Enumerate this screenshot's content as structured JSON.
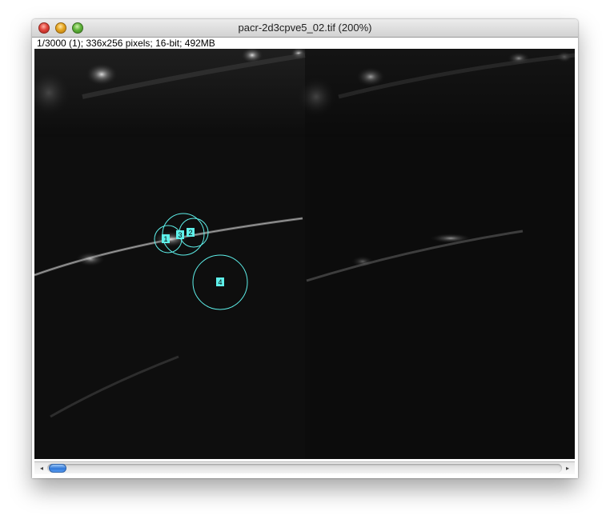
{
  "window": {
    "title": "pacr-2d3cpve5_02.tif (200%)",
    "info": "1/3000 (1); 336x256 pixels; 16-bit; 492MB"
  },
  "roi_color": "#5ef0ea",
  "rois": [
    {
      "label": "1"
    },
    {
      "label": "2"
    },
    {
      "label": "3"
    },
    {
      "label": "4"
    }
  ],
  "scrollbar": {
    "left_arrow": "◂",
    "right_arrow": "▸"
  },
  "icons": {
    "close": "close-button",
    "minimize": "minimize-button",
    "zoom": "zoom-button"
  }
}
